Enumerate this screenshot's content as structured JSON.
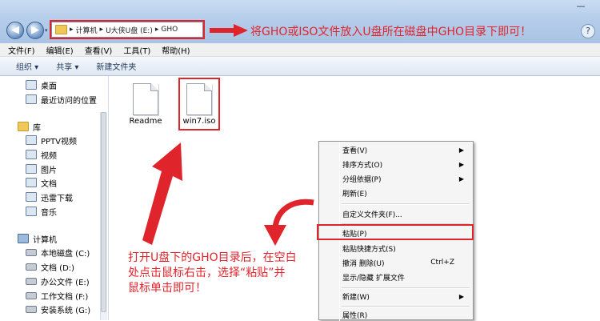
{
  "window": {
    "address_path": [
      "计算机",
      "U大侠U盘 (E:)",
      "GHO"
    ],
    "instruction_top": "将GHO或ISO文件放入U盘所在磁盘中GHO目录下即可！",
    "help_label": "?",
    "minimize_label": "—"
  },
  "menubar": [
    {
      "label": "文件(F)"
    },
    {
      "label": "编辑(E)"
    },
    {
      "label": "查看(V)"
    },
    {
      "label": "工具(T)"
    },
    {
      "label": "帮助(H)"
    }
  ],
  "cmdbar": [
    {
      "label": "组织 ▾"
    },
    {
      "label": "共享 ▾"
    },
    {
      "label": "新建文件夹"
    }
  ],
  "navpane": {
    "favorites": [
      {
        "label": "桌面"
      },
      {
        "label": "最近访问的位置"
      }
    ],
    "library": {
      "label": "库"
    },
    "library_items": [
      {
        "label": "PPTV视频"
      },
      {
        "label": "视频"
      },
      {
        "label": "图片"
      },
      {
        "label": "文档"
      },
      {
        "label": "迅雷下载"
      },
      {
        "label": "音乐"
      }
    ],
    "computer": {
      "label": "计算机"
    },
    "drives": [
      {
        "label": "本地磁盘 (C:)"
      },
      {
        "label": "文档 (D:)"
      },
      {
        "label": "办公文件 (E:)"
      },
      {
        "label": "工作文档 (F:)"
      },
      {
        "label": "安装系统 (G:)"
      }
    ]
  },
  "files": [
    {
      "name": "Readme"
    },
    {
      "name": "win7.iso"
    }
  ],
  "context_menu": {
    "items": [
      {
        "label": "查看(V)",
        "arrow": "▶"
      },
      {
        "label": "排序方式(O)",
        "arrow": "▶"
      },
      {
        "label": "分组依据(P)",
        "arrow": "▶"
      },
      {
        "label": "刷新(E)"
      },
      {
        "label": "自定义文件夹(F)..."
      },
      {
        "label": "粘贴(P)"
      },
      {
        "label": "粘贴快捷方式(S)"
      },
      {
        "label": "撤消 删除(U)",
        "shortcut": "Ctrl+Z"
      },
      {
        "label": "显示/隐藏 扩展文件"
      },
      {
        "label": "新建(W)",
        "arrow": "▶"
      },
      {
        "label": "属性(R)"
      }
    ]
  },
  "annotation": {
    "line1": "打开U盘下的GHO目录后，在空白",
    "line2": "处点击鼠标右击，选择“粘贴”并",
    "line3": "鼠标单击即可！"
  },
  "colors": {
    "annotation_red": "#e0242b",
    "title_blue": "#b5cdea"
  }
}
